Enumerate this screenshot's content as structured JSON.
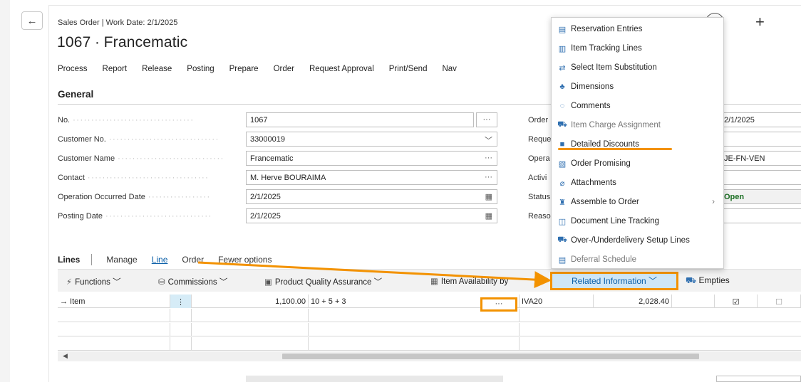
{
  "header": {
    "subtitle": "Sales Order | Work Date: 2/1/2025",
    "title": "1067 ∙ Francematic",
    "help_glyph": "?",
    "plus_glyph": "+",
    "back_glyph": "←"
  },
  "actions": [
    "Process",
    "Report",
    "Release",
    "Posting",
    "Prepare",
    "Order",
    "Request Approval",
    "Print/Send",
    "Nav"
  ],
  "general": {
    "heading": "General",
    "fields": [
      {
        "label": "No.",
        "value": "1067",
        "suffix": "···"
      },
      {
        "label": "Customer No.",
        "value": "33000019",
        "suffix": "﹀"
      },
      {
        "label": "Customer Name",
        "value": "Francematic",
        "suffix": "···"
      },
      {
        "label": "Contact",
        "value": "M. Herve BOURAIMA",
        "suffix": "···"
      },
      {
        "label": "Operation Occurred Date",
        "value": "2/1/2025",
        "suffix": "▦"
      },
      {
        "label": "Posting Date",
        "value": "2/1/2025",
        "suffix": "▦"
      }
    ],
    "right_labels": [
      "Order",
      "Reque",
      "Opera",
      "Activi",
      "Status",
      "Reaso"
    ],
    "right_values": [
      "2/1/2025",
      "",
      "JE-FN-VEN",
      "",
      "Open",
      ""
    ]
  },
  "lines": {
    "label": "Lines",
    "tabs": [
      "Manage",
      "Line",
      "Order",
      "Fewer options"
    ],
    "toolbar": {
      "functions": "Functions",
      "commissions": "Commissions",
      "pqa": "Product Quality Assurance",
      "availability": "Item Availability by",
      "related": "Related Information",
      "empties": "Empties"
    },
    "row1": {
      "type": "→ Item",
      "menu": "⋮",
      "quantity": "1,100.00",
      "discount": "10 + 5 + 3",
      "more": "···",
      "vat_group": "IVA20",
      "amount": "2,028.40"
    }
  },
  "menu": {
    "items": [
      {
        "label": "Reservation Entries",
        "icon": "▤"
      },
      {
        "label": "Item Tracking Lines",
        "icon": "▥"
      },
      {
        "label": "Select Item Substitution",
        "icon": "⇄"
      },
      {
        "label": "Dimensions",
        "icon": "♣"
      },
      {
        "label": "Comments",
        "icon": "◌"
      },
      {
        "label": "Item Charge Assignment",
        "icon": "⛟"
      },
      {
        "label": "Detailed Discounts",
        "icon": "■"
      },
      {
        "label": "Order Promising",
        "icon": "▧"
      },
      {
        "label": "Attachments",
        "icon": "⌀"
      },
      {
        "label": "Assemble to Order",
        "icon": "♜",
        "chevron": "›"
      },
      {
        "label": "Document Line Tracking",
        "icon": "◫"
      },
      {
        "label": "Over-/Underdelivery Setup Lines",
        "icon": "⛟"
      },
      {
        "label": "Deferral Schedule",
        "icon": "▤"
      }
    ]
  },
  "colors": {
    "highlight": "#f39200",
    "link": "#0a5fa8",
    "status_open": "#1a6e22"
  }
}
